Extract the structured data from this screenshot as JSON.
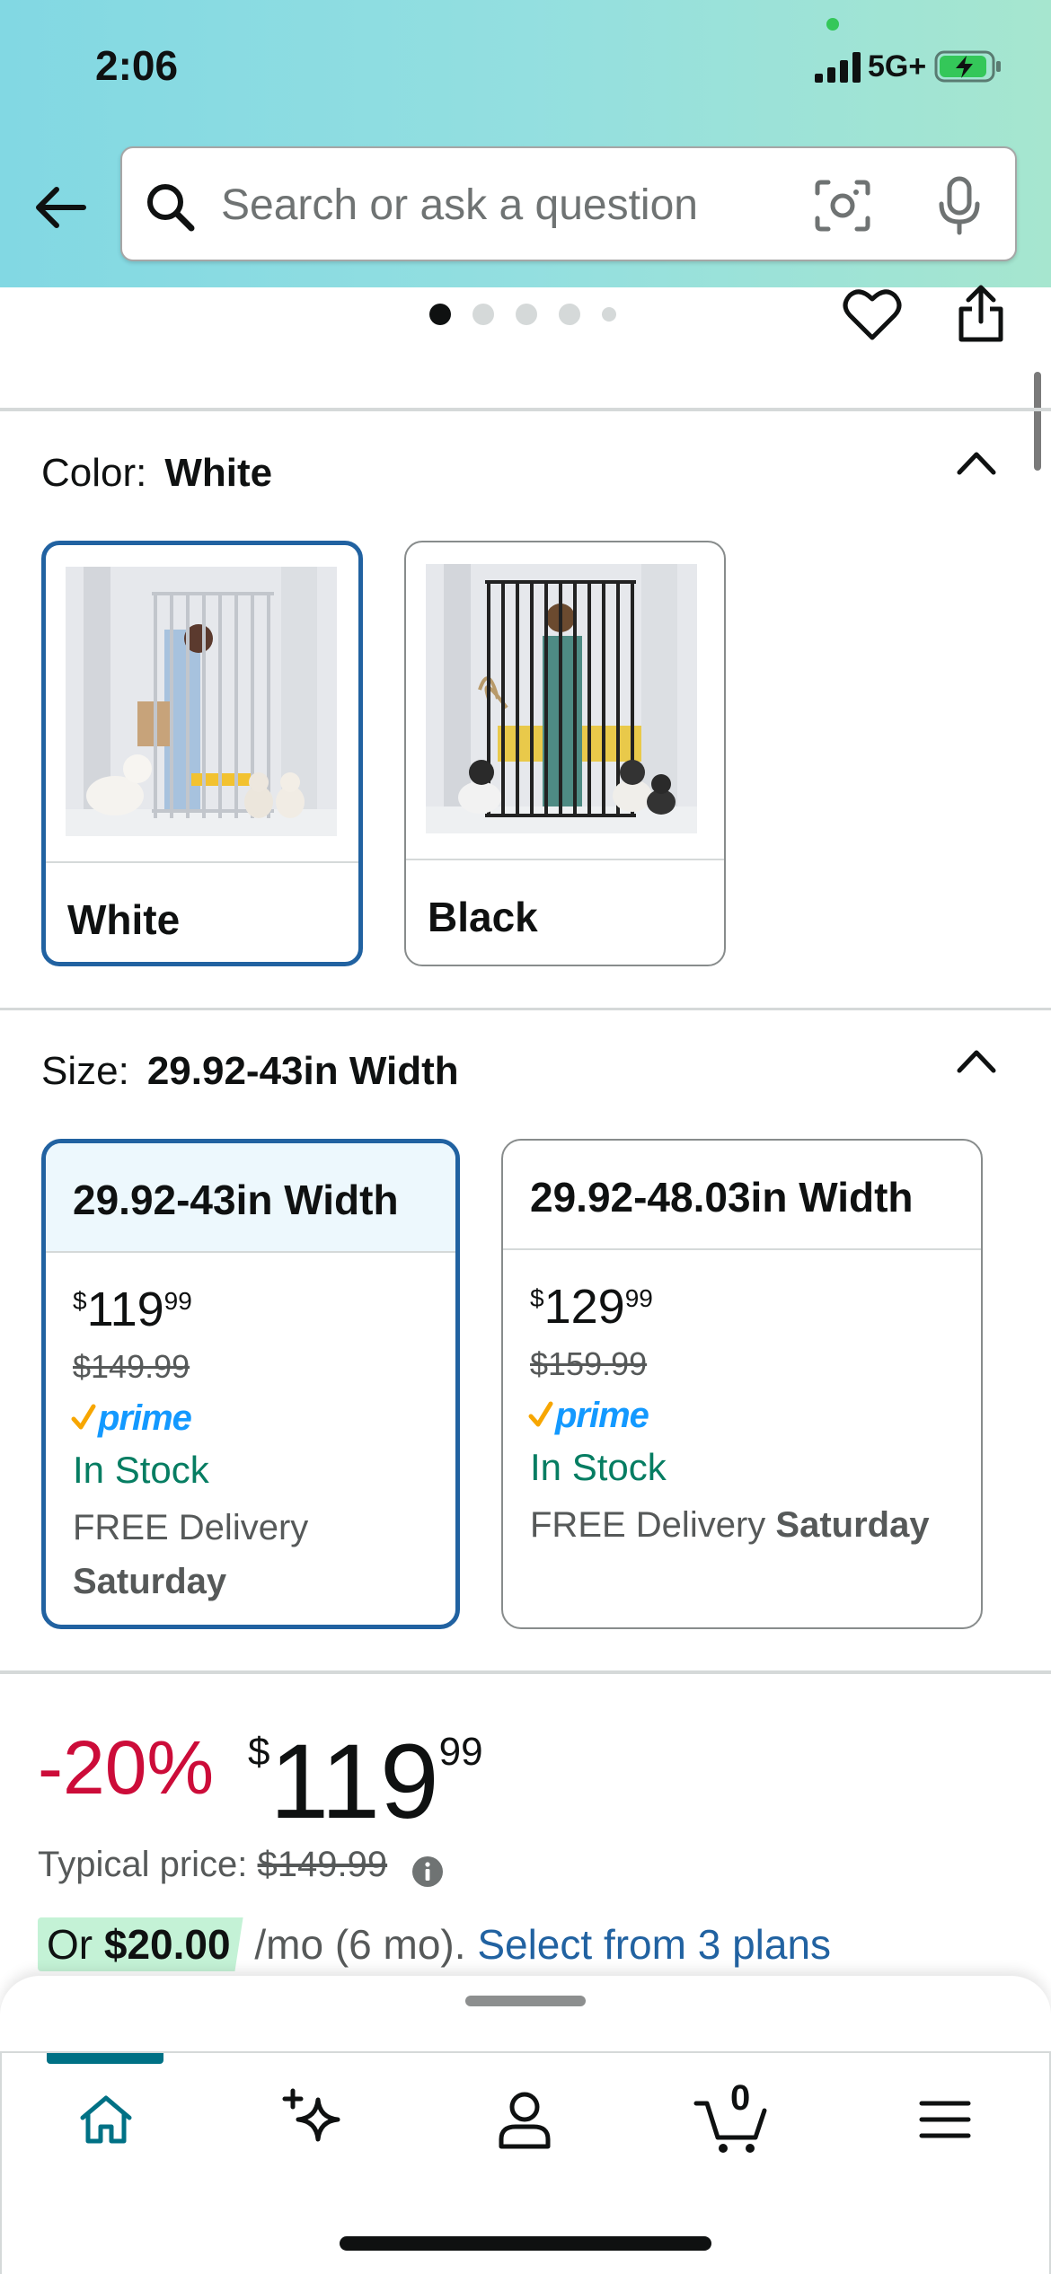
{
  "status_bar": {
    "time": "2:06",
    "network": "5G+"
  },
  "search": {
    "placeholder": "Search or ask a question"
  },
  "colors": {
    "accent_blue": "#2162a1",
    "deal_red": "#cc0c39",
    "stock_green": "#067d62",
    "prime_blue": "#1399ff",
    "header_gradient": "#82d8e3"
  },
  "gallery": {
    "dot_count": 5,
    "active_index": 0
  },
  "color_section": {
    "label": "Color:",
    "selected_value": "White",
    "options": [
      {
        "name": "White",
        "selected": true
      },
      {
        "name": "Black",
        "selected": false
      }
    ]
  },
  "size_section": {
    "label": "Size:",
    "selected_value": "29.92-43in Width",
    "options": [
      {
        "name": "29.92-43in Width",
        "price_currency": "$",
        "price_whole": "119",
        "price_fraction": "99",
        "list_price": "$149.99",
        "prime": "prime",
        "stock": "In Stock",
        "delivery_text": "FREE Delivery",
        "delivery_day": "Saturday",
        "selected": true
      },
      {
        "name": "29.92-48.03in Width",
        "price_currency": "$",
        "price_whole": "129",
        "price_fraction": "99",
        "list_price": "$159.99",
        "prime": "prime",
        "stock": "In Stock",
        "delivery_text": "FREE Delivery",
        "delivery_day": "Saturday",
        "selected": false
      }
    ]
  },
  "price_block": {
    "discount": "-20%",
    "currency": "$",
    "whole": "119",
    "fraction": "99",
    "typical_label": "Typical price:",
    "typical_price": "$149.99",
    "plan_prefix": "Or",
    "plan_amount": "$20.00",
    "plan_term": "/mo (6 mo).",
    "plan_link": "Select from 3 plans"
  },
  "tab_bar": {
    "items": [
      {
        "icon": "home-icon",
        "active": true
      },
      {
        "icon": "ai-sparkle-icon",
        "active": false
      },
      {
        "icon": "account-icon",
        "active": false
      },
      {
        "icon": "cart-icon",
        "active": false,
        "badge": "0"
      },
      {
        "icon": "menu-icon",
        "active": false
      }
    ]
  }
}
